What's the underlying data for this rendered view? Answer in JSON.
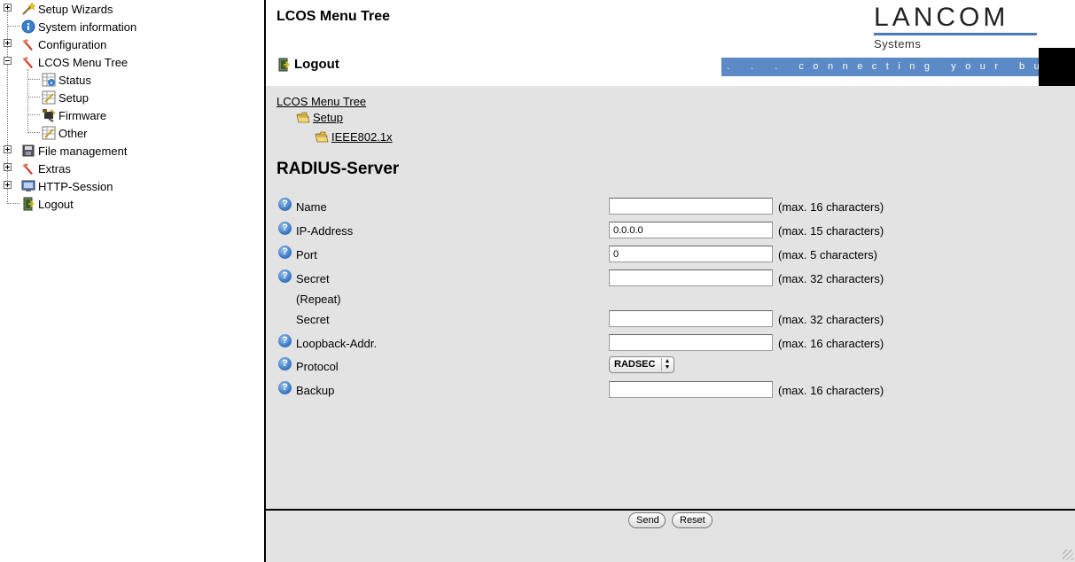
{
  "tree": {
    "items": [
      {
        "label": "Setup Wizards",
        "icon": "wand-icon",
        "expander": "plus"
      },
      {
        "label": "System information",
        "icon": "info-icon",
        "expander": "none"
      },
      {
        "label": "Configuration",
        "icon": "config-icon",
        "expander": "plus"
      },
      {
        "label": "LCOS Menu Tree",
        "icon": "config-icon",
        "expander": "minus"
      },
      {
        "label": "Status",
        "icon": "status-icon",
        "child": true
      },
      {
        "label": "Setup",
        "icon": "setup-icon",
        "child": true
      },
      {
        "label": "Firmware",
        "icon": "firmware-icon",
        "child": true
      },
      {
        "label": "Other",
        "icon": "setup-icon",
        "child": true
      },
      {
        "label": "File management",
        "icon": "disk-icon",
        "expander": "plus"
      },
      {
        "label": "Extras",
        "icon": "config-icon",
        "expander": "plus"
      },
      {
        "label": "HTTP-Session",
        "icon": "monitor-icon",
        "expander": "plus"
      },
      {
        "label": "Logout",
        "icon": "logout-icon",
        "expander": "none"
      }
    ]
  },
  "header": {
    "title": "LCOS Menu Tree",
    "logo_word": "LANCOM",
    "logo_sub": "Systems",
    "logout": "Logout",
    "tagline": ". . .   connecting   your   business"
  },
  "breadcrumb": {
    "root": "LCOS Menu Tree",
    "level1": "Setup",
    "level2": "IEEE802.1x"
  },
  "form": {
    "title": "RADIUS-Server",
    "fields": {
      "name": {
        "label": "Name",
        "value": "",
        "hint": "(max. 16 characters)"
      },
      "ip": {
        "label": "IP-Address",
        "value": "0.0.0.0",
        "hint": "(max. 15 characters)"
      },
      "port": {
        "label": "Port",
        "value": "0",
        "hint": "(max. 5 characters)"
      },
      "secret": {
        "label": "Secret",
        "value": "",
        "hint": "(max. 32 characters)"
      },
      "repeat_label": "(Repeat)",
      "secret2": {
        "label": "Secret",
        "value": "",
        "hint": "(max. 32 characters)"
      },
      "loopback": {
        "label": "Loopback-Addr.",
        "value": "",
        "hint": "(max. 16 characters)"
      },
      "protocol": {
        "label": "Protocol",
        "selected": "RADSEC"
      },
      "backup": {
        "label": "Backup",
        "value": "",
        "hint": "(max. 16 characters)"
      }
    }
  },
  "footer": {
    "send": "Send",
    "reset": "Reset"
  },
  "colors": {
    "tagbar": "#5b8ac6",
    "logo_bar": "#4a7bb7",
    "content_bg": "#e3e3e4"
  }
}
